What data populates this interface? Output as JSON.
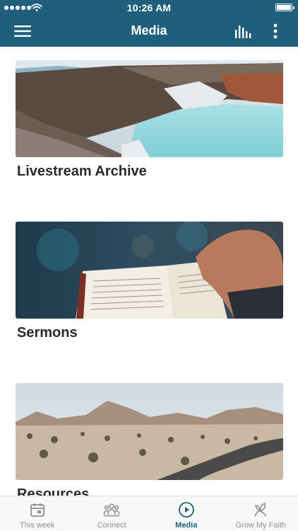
{
  "status_bar": {
    "time": "10:26 AM"
  },
  "nav": {
    "title": "Media",
    "menu_icon": "hamburger-menu-icon",
    "chart_icon": "bar-chart-icon",
    "more_icon": "vertical-ellipsis-icon"
  },
  "cards": [
    {
      "title": "Livestream Archive",
      "image": "crater-lake-photo"
    },
    {
      "title": "Sermons",
      "image": "open-bible-photo"
    },
    {
      "title": "Resources",
      "image": "desert-road-photo"
    }
  ],
  "tabs": [
    {
      "label": "This week",
      "icon": "calendar-icon",
      "active": false
    },
    {
      "label": "Connect",
      "icon": "people-icon",
      "active": false
    },
    {
      "label": "Media",
      "icon": "play-circle-icon",
      "active": true
    },
    {
      "label": "Grow My Faith",
      "icon": "sprout-icon",
      "active": false
    }
  ],
  "colors": {
    "brand": "#1f5f7c",
    "inactive_tab": "#8e8e93",
    "title_text": "#2a2a2a"
  }
}
